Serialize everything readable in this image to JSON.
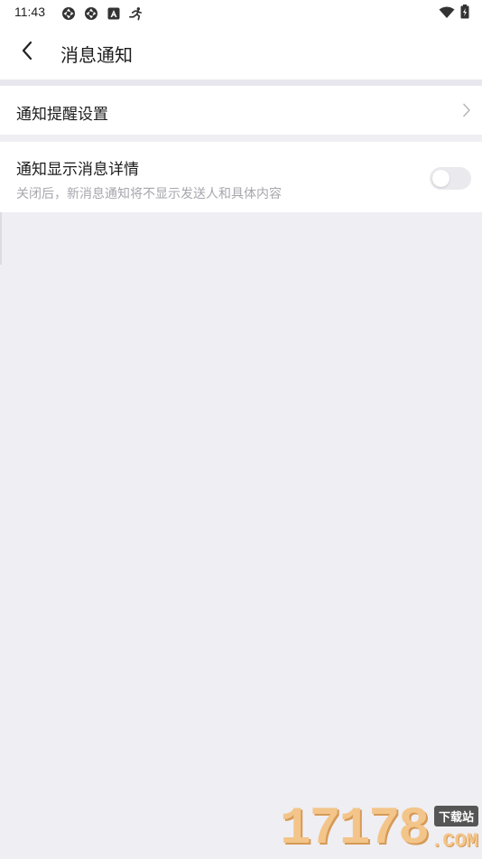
{
  "status_bar": {
    "time": "11:43",
    "left_icons": [
      "aperture-icon",
      "aperture-icon",
      "a-notification-icon",
      "running-icon"
    ],
    "right_icons": [
      "wifi-icon",
      "battery-charging-icon"
    ]
  },
  "header": {
    "back_icon": "chevron-left-icon",
    "title": "消息通知"
  },
  "settings": {
    "reminder": {
      "label": "通知提醒设置",
      "icon": "chevron-right-icon"
    },
    "detail": {
      "title": "通知显示消息详情",
      "description": "关闭后，新消息通知将不显示发送人和具体内容",
      "toggle_on": false
    }
  },
  "watermark": {
    "digits": "17178",
    "badge": "下载站",
    "suffix": ".COM"
  },
  "colors": {
    "background": "#efeef3",
    "surface": "#ffffff",
    "text_primary": "#1c1c1c",
    "text_secondary": "#a6a6ad",
    "toggle_off": "#eaeaee",
    "watermark_fill": "#f3c58a"
  }
}
